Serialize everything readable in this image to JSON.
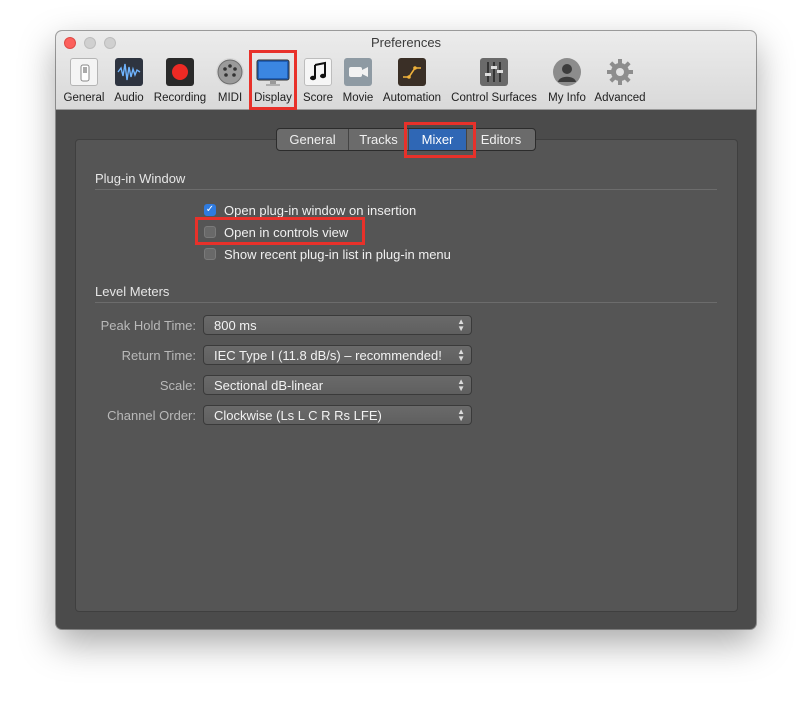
{
  "window": {
    "title": "Preferences"
  },
  "toolbar": {
    "items": [
      {
        "label": "General",
        "icon": "switch-icon"
      },
      {
        "label": "Audio",
        "icon": "waveform-icon"
      },
      {
        "label": "Recording",
        "icon": "record-icon"
      },
      {
        "label": "MIDI",
        "icon": "midi-connector-icon"
      },
      {
        "label": "Display",
        "icon": "monitor-icon"
      },
      {
        "label": "Score",
        "icon": "music-note-icon"
      },
      {
        "label": "Movie",
        "icon": "video-camera-icon"
      },
      {
        "label": "Automation",
        "icon": "automation-curve-icon"
      },
      {
        "label": "Control Surfaces",
        "icon": "faders-icon"
      },
      {
        "label": "My Info",
        "icon": "person-icon"
      },
      {
        "label": "Advanced",
        "icon": "gear-icon"
      }
    ],
    "selected": "Display"
  },
  "tabs": {
    "items": [
      "General",
      "Tracks",
      "Mixer",
      "Editors"
    ],
    "selected": "Mixer"
  },
  "plugin_window": {
    "title": "Plug-in Window",
    "options": [
      {
        "label": "Open plug-in window on insertion",
        "checked": true
      },
      {
        "label": "Open in controls view",
        "checked": false
      },
      {
        "label": "Show recent plug-in list in plug-in menu",
        "checked": false
      }
    ]
  },
  "level_meters": {
    "title": "Level Meters",
    "fields": [
      {
        "label": "Peak Hold Time:",
        "value": "800 ms"
      },
      {
        "label": "Return Time:",
        "value": "IEC Type I (11.8 dB/s) – recommended!"
      },
      {
        "label": "Scale:",
        "value": "Sectional dB-linear"
      },
      {
        "label": "Channel Order:",
        "value": "Clockwise (Ls L C R Rs LFE)"
      }
    ]
  },
  "colors": {
    "highlight": "#e8312a",
    "accent": "#2f67b5",
    "checkbox_checked": "#2f7be0"
  }
}
